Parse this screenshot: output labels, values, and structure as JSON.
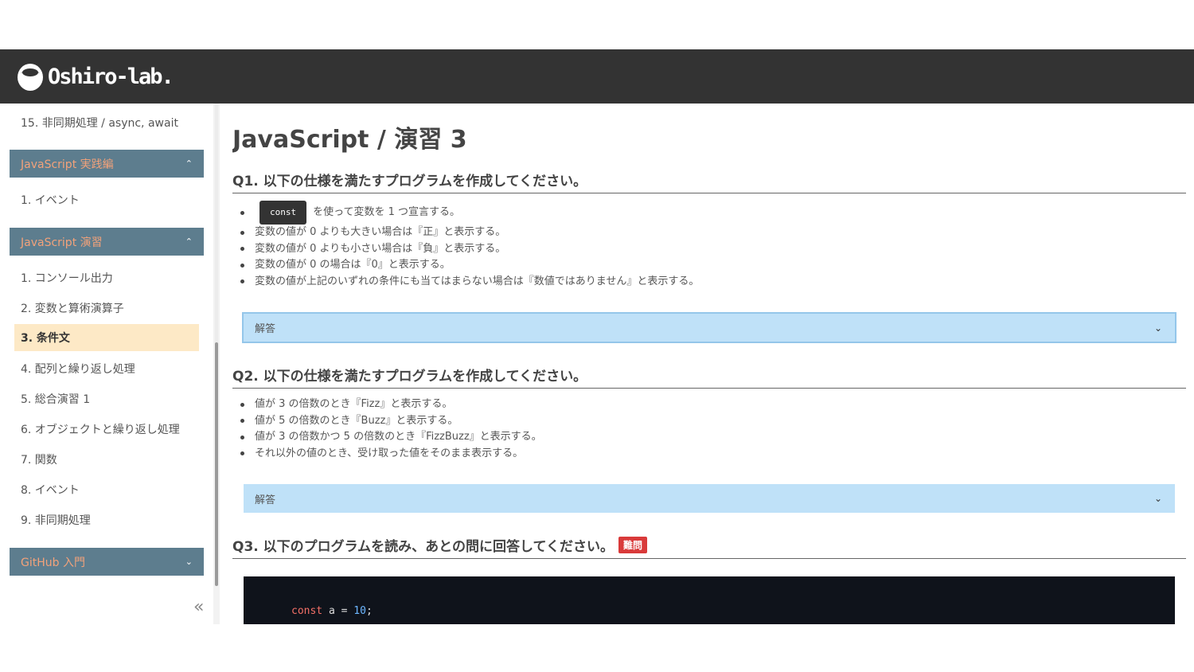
{
  "header": {
    "logo_text": "Oshiro-lab."
  },
  "sidebar": {
    "top_link": "15. 非同期処理 / async, await",
    "sections": [
      {
        "title": "JavaScript 実践編",
        "chevron": "^",
        "items": [
          "1. イベント"
        ]
      },
      {
        "title": "JavaScript 演習",
        "chevron": "^",
        "items": [
          "1. コンソール出力",
          "2. 変数と算術演算子",
          "3. 条件文",
          "4. 配列と繰り返し処理",
          "5. 総合演習 1",
          "6. オブジェクトと繰り返し処理",
          "7. 関数",
          "8. イベント",
          "9. 非同期処理"
        ],
        "active_item": "3. 条件文"
      },
      {
        "title": "GitHub 入門",
        "chevron": "v"
      }
    ],
    "collapse_icon": "«"
  },
  "main": {
    "title": "JavaScript / 演習 3",
    "q1": {
      "title": "Q1. 以下の仕様を満たすプログラムを作成してください。",
      "code_chip": "const",
      "chip_suffix": "を使って変数を 1 つ宣言する。",
      "bullets": [
        "変数の値が 0 よりも大きい場合は『正』と表示する。",
        "変数の値が 0 よりも小さい場合は『負』と表示する。",
        "変数の値が 0 の場合は『0』と表示する。",
        "変数の値が上記のいずれの条件にも当てはまらない場合は『数値ではありません』と表示する。"
      ],
      "answer_label": "解答"
    },
    "q2": {
      "title": "Q2. 以下の仕様を満たすプログラムを作成してください。",
      "bullets": [
        "値が 3 の倍数のとき『Fizz』と表示する。",
        "値が 5 の倍数のとき『Buzz』と表示する。",
        "値が 3 の倍数かつ 5 の倍数のとき『FizzBuzz』と表示する。",
        "それ以外の値のとき、受け取った値をそのまま表示する。"
      ],
      "answer_label": "解答"
    },
    "q3": {
      "title": "Q3. 以下のプログラムを読み、あとの問に回答してください。",
      "badge": "難問",
      "code": {
        "keyword": "const",
        "rest": " a = ",
        "number": "10",
        "end": ";"
      }
    }
  }
}
